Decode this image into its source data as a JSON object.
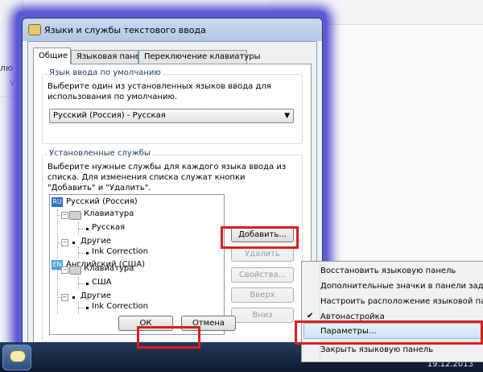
{
  "background": {
    "fragment_text": "лю вызвать справ",
    "fragment_label": "V"
  },
  "dialog": {
    "title": "Языки и службы текстового ввода",
    "tabs": [
      {
        "label": "Общие"
      },
      {
        "label": "Языковая панель"
      },
      {
        "label": "Переключение клавиатуры"
      }
    ],
    "default_group": {
      "label": "Язык ввода по умолчанию",
      "description": "Выберите один из установленных языков ввода для использования по умолчанию.",
      "selected": "Русский (Россия) - Русская"
    },
    "installed_group": {
      "label": "Установленные службы",
      "description": "Выберите нужные службы для каждого языка ввода из списка. Для изменения списка служат кнопки \"Добавить\" и \"Удалить\"."
    },
    "tree": [
      {
        "badge": "RU",
        "label": "Русский (Россия)"
      },
      {
        "label": "Клавиатура"
      },
      {
        "label": "Русская"
      },
      {
        "label": "Другие"
      },
      {
        "label": "Ink Correction"
      },
      {
        "badge": "EN",
        "label": "Английский (США)"
      },
      {
        "label": "Клавиатура"
      },
      {
        "label": "США"
      },
      {
        "label": "Другие"
      },
      {
        "label": "Ink Correction"
      }
    ],
    "buttons": {
      "add": "Добавить...",
      "remove": "Удалить",
      "properties": "Свойства...",
      "up": "Вверх",
      "down": "Вниз",
      "ok": "ОК",
      "cancel": "Отмена"
    }
  },
  "context_menu": {
    "items": [
      {
        "label": "Восстановить языковую панель"
      },
      {
        "label": "Дополнительные значки в панели задач"
      },
      {
        "label": "Настроить расположение языковой панели"
      },
      {
        "label": "Автонастройка",
        "checked": true
      },
      {
        "label": "Параметры...",
        "highlighted": true
      },
      {
        "label": "Закрыть языковую панель"
      }
    ]
  },
  "taskbar": {
    "clock_date": "19.12.2013"
  },
  "colors": {
    "highlight_red": "#d81e1e",
    "ru_badge": "#2b6fc4",
    "en_badge": "#4aa3df",
    "dialog_glow": "#5c5bd6"
  }
}
